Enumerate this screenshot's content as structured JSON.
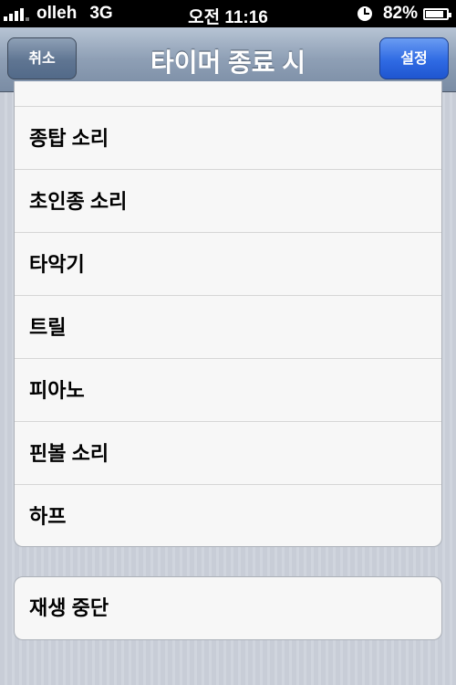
{
  "status_bar": {
    "carrier": "olleh",
    "network": "3G",
    "time": "오전 11:16",
    "battery": "82%"
  },
  "nav": {
    "title": "타이머 종료 시",
    "cancel_label": "취소",
    "set_label": "설정"
  },
  "sounds": [
    {
      "label": "종탑 소리"
    },
    {
      "label": "초인종 소리"
    },
    {
      "label": "타악기"
    },
    {
      "label": "트릴"
    },
    {
      "label": "피아노"
    },
    {
      "label": "핀볼 소리"
    },
    {
      "label": "하프"
    }
  ],
  "stop_playing": {
    "label": "재생 중단"
  },
  "icons": [
    "signal-icon",
    "clock-icon",
    "battery-icon"
  ]
}
